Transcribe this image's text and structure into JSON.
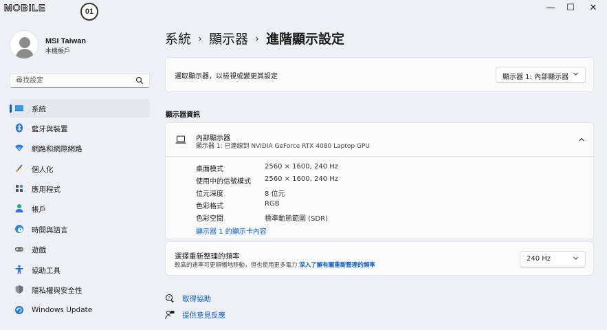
{
  "app": {
    "logo_text": "MOBILE",
    "logo_badge": "01"
  },
  "window_controls": {
    "minimize": "—",
    "maximize": "☐",
    "close": "✕"
  },
  "profile": {
    "name": "MSI Taiwan",
    "account_type": "本機帳戶"
  },
  "search": {
    "placeholder": "尋找設定"
  },
  "nav": {
    "items": [
      {
        "label": "系統",
        "icon": "system-icon",
        "active": true
      },
      {
        "label": "藍牙與裝置",
        "icon": "bluetooth-icon"
      },
      {
        "label": "網路和網際網路",
        "icon": "wifi-icon"
      },
      {
        "label": "個人化",
        "icon": "brush-icon"
      },
      {
        "label": "應用程式",
        "icon": "apps-icon"
      },
      {
        "label": "帳戶",
        "icon": "person-icon"
      },
      {
        "label": "時間與語言",
        "icon": "globe-clock-icon"
      },
      {
        "label": "遊戲",
        "icon": "gamepad-icon"
      },
      {
        "label": "協助工具",
        "icon": "accessibility-icon"
      },
      {
        "label": "隱私權與安全性",
        "icon": "shield-icon"
      },
      {
        "label": "Windows Update",
        "icon": "update-icon"
      }
    ]
  },
  "breadcrumb": {
    "level1": "系統",
    "level2": "顯示器",
    "current": "進階顯示設定",
    "separator": "›"
  },
  "display_select": {
    "label": "選取顯示器，以檢視或變更其設定",
    "value": "顯示器 1: 內部顯示器"
  },
  "section_title": "顯示器資訊",
  "display_info": {
    "title": "內部顯示器",
    "subtitle": "顯示器 1: 已連線到 NVIDIA GeForce RTX 4080 Laptop GPU",
    "rows": [
      {
        "key": "桌面模式",
        "value": "2560 × 1600, 240 Hz"
      },
      {
        "key": "使用中的信號模式",
        "value": "2560 × 1600, 240 Hz"
      },
      {
        "key": "位元深度",
        "value": "8 位元"
      },
      {
        "key": "色彩格式",
        "value": "RGB"
      },
      {
        "key": "色彩空間",
        "value": "標準動態範圍 (SDR)"
      }
    ],
    "adapter_link": "顯示器 1 的顯示卡內容"
  },
  "refresh_rate": {
    "title": "選擇重新整理的頻率",
    "description": "較高的速率可更順暢地移動，但也使用更多電力",
    "learn_more": "深入了解有關重新整理的頻率",
    "value": "240 Hz"
  },
  "help": {
    "get_help": "取得協助",
    "feedback": "提供意見反應"
  },
  "colors": {
    "accent": "#0a5ec4",
    "background": "#eef0f6",
    "card": "#fbfbfc"
  }
}
